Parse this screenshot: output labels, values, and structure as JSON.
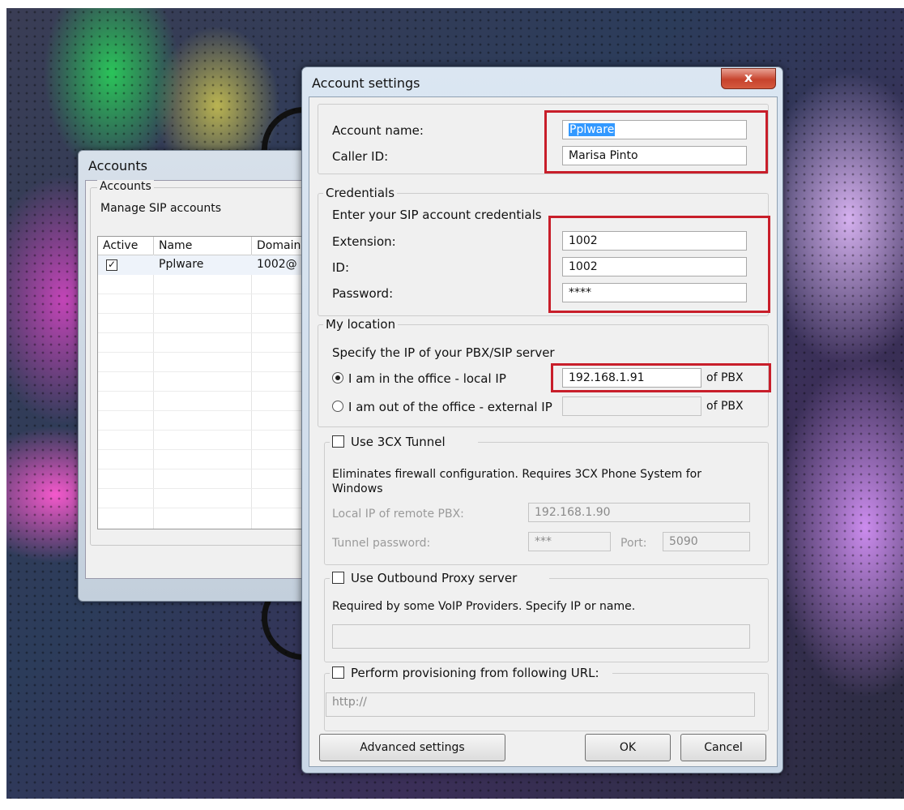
{
  "accounts_window": {
    "title": "Accounts",
    "group_title": "Accounts",
    "subtitle": "Manage SIP accounts",
    "columns": [
      "Active",
      "Name",
      "Domain"
    ],
    "rows": [
      {
        "active": true,
        "name": "Pplware",
        "domain": "1002@"
      }
    ]
  },
  "dialog": {
    "title": "Account settings",
    "close_label": "x",
    "account_name_label": "Account name:",
    "account_name_value": "Pplware",
    "caller_id_label": "Caller ID:",
    "caller_id_value": "Marisa Pinto",
    "credentials": {
      "title": "Credentials",
      "hint": "Enter your SIP account credentials",
      "extension_label": "Extension:",
      "extension_value": "1002",
      "id_label": "ID:",
      "id_value": "1002",
      "password_label": "Password:",
      "password_value": "****"
    },
    "location": {
      "title": "My location",
      "hint": "Specify the IP of your PBX/SIP server",
      "local_label": "I am in the office - local IP",
      "local_value": "192.168.1.91",
      "local_suffix": "of PBX",
      "external_label": "I am out of the office - external IP",
      "external_value": "",
      "external_suffix": "of PBX",
      "selected": "local"
    },
    "tunnel": {
      "title": "Use 3CX Tunnel",
      "description": "Eliminates firewall configuration. Requires 3CX Phone System for Windows",
      "local_ip_label": "Local IP of remote PBX:",
      "local_ip_value": "192.168.1.90",
      "password_label": "Tunnel password:",
      "password_value": "***",
      "port_label": "Port:",
      "port_value": "5090"
    },
    "proxy": {
      "title": "Use Outbound Proxy server",
      "description": "Required by some VoIP Providers. Specify IP or name.",
      "value": ""
    },
    "provisioning": {
      "title": "Perform provisioning from following URL:",
      "value": "http://"
    },
    "buttons": {
      "advanced": "Advanced settings",
      "ok": "OK",
      "cancel": "Cancel"
    }
  }
}
